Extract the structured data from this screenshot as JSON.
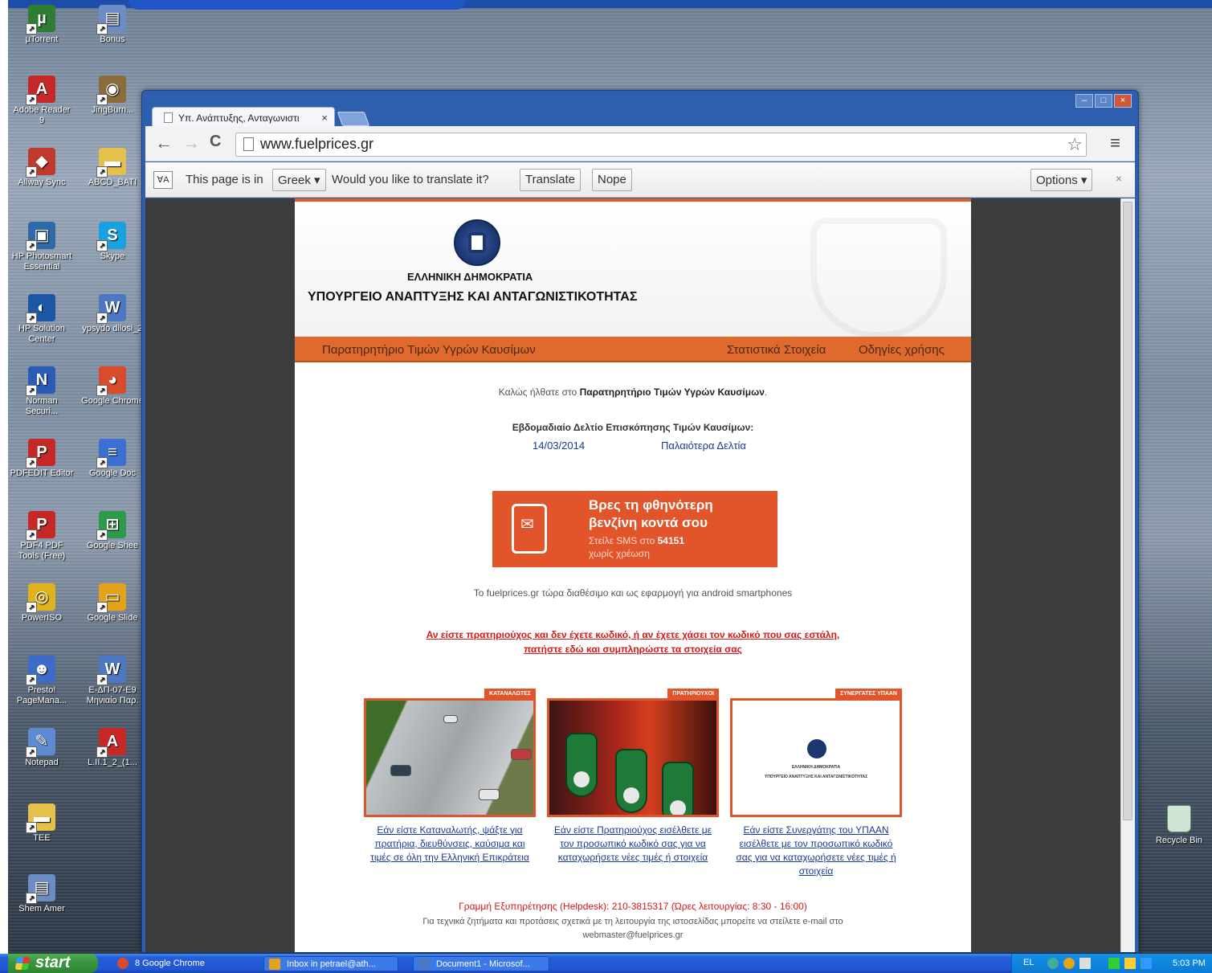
{
  "desktop": {
    "icons": [
      {
        "label": "µTorrent",
        "color": "#2f7d32",
        "glyph": "µ"
      },
      {
        "label": "Bonus",
        "color": "#6b8cc4",
        "glyph": "▤"
      },
      {
        "label": "Adobe Reader 9",
        "color": "#c62828",
        "glyph": "A"
      },
      {
        "label": "JingBurn...",
        "color": "#8a6d3b",
        "glyph": "◉"
      },
      {
        "label": "Allway Sync",
        "color": "#c0392b",
        "glyph": "◆"
      },
      {
        "label": "ABCD_BATI",
        "color": "#e5c04a",
        "glyph": "▬"
      },
      {
        "label": "HP Photosmart Essential",
        "color": "#2e6aa8",
        "glyph": "▣"
      },
      {
        "label": "Skype",
        "color": "#1aa1e0",
        "glyph": "S"
      },
      {
        "label": "HP Solution Center",
        "color": "#1c56a5",
        "glyph": "◐"
      },
      {
        "label": "ypsydo dilosi_2",
        "color": "#4c77c2",
        "glyph": "W"
      },
      {
        "label": "Norman Securi...",
        "color": "#2a5bb5",
        "glyph": "N"
      },
      {
        "label": "Google Chrome",
        "color": "#d94b2b",
        "glyph": "◕"
      },
      {
        "label": "PDFEDIT Editor",
        "color": "#c62828",
        "glyph": "P"
      },
      {
        "label": "Google Doc",
        "color": "#3b6fd1",
        "glyph": "≡"
      },
      {
        "label": "PDF4 PDF Tools (Free)",
        "color": "#c62828",
        "glyph": "P"
      },
      {
        "label": "Google Shee",
        "color": "#2c9a4a",
        "glyph": "⊞"
      },
      {
        "label": "PowerISO",
        "color": "#e0b21e",
        "glyph": "◎"
      },
      {
        "label": "Google Slide",
        "color": "#e3a21a",
        "glyph": "▭"
      },
      {
        "label": "Presto! PageMana...",
        "color": "#3c6cc9",
        "glyph": "☻"
      },
      {
        "label": "E-ΔΠ-07-Ε9 Μηνιαίο Παρ.",
        "color": "#4c77c2",
        "glyph": "W"
      },
      {
        "label": "Notepad",
        "color": "#5d8ad0",
        "glyph": "✎"
      },
      {
        "label": "L.II.1_2_(1...",
        "color": "#c62828",
        "glyph": "A"
      },
      {
        "label": "TEE",
        "color": "#e5c04a",
        "glyph": "▬"
      },
      {
        "label": "Shem Amer",
        "color": "#6b8cc4",
        "glyph": "▤"
      }
    ],
    "recycle_bin": "Recycle Bin"
  },
  "browser": {
    "tab_title": "Υπ. Ανάπτυξης, Ανταγωνιστι",
    "tab_close": "×",
    "win_controls": [
      "–",
      "□",
      "×"
    ],
    "nav": {
      "back": "←",
      "forward": "→",
      "reload": "C"
    },
    "url": "www.fuelprices.gr",
    "star": "☆",
    "menu": "≡",
    "translate_bar": {
      "icon": "ⱯA",
      "text_before": "This page is in",
      "language": "Greek ▾",
      "question": "Would you like to translate it?",
      "translate_button": "Translate",
      "nope_button": "Nope",
      "options_button": "Options ▾",
      "close": "×"
    }
  },
  "site": {
    "header_line1": "ΕΛΛΗΝΙΚΗ ΔΗΜΟΚΡΑΤΙΑ",
    "header_line2": "ΥΠΟΥΡΓΕΙΟ ΑΝΑΠΤΥΞΗΣ ΚΑΙ ΑΝΤΑΓΩΝΙΣΤΙΚΟΤΗΤΑΣ",
    "nav_left": "Παρατηρητήριο Τιμών Υγρών Καυσίμων",
    "nav_stats": "Στατιστικά Στοιχεία",
    "nav_guide": "Οδηγίες χρήσης",
    "welcome_prefix": "Καλώς ήλθατε στο",
    "welcome_bold": "Παρατηρητήριο Τιμών Υγρών Καυσίμων",
    "weekly_title": "Εβδομαδιαίο Δελτίο Επισκόπησης Τιμών Καυσίμων:",
    "weekly_date": "14/03/2014",
    "older_bulletins": "Παλαιότερα Δελτία",
    "sms_line1": "Βρες τη φθηνότερη",
    "sms_line2": "βενζίνη κοντά σου",
    "sms_line3_prefix": "Στείλε SMS στο",
    "sms_number": "54151",
    "sms_line4": "χωρίς χρέωση",
    "android_text": "Το fuelprices.gr τώρα διαθέσιμο και ως εφαρμογή για android smartphones",
    "red_link_line1": "Αν είστε πρατηριούχος και δεν έχετε κωδικό, ή αν έχετε χάσει τον κωδικό που σας εστάλη,",
    "red_link_line2": "πατήστε εδώ και συμπληρώστε τα στοιχεία σας",
    "cards": [
      {
        "tag": "ΚΑΤΑΝΑΛΩΤΕΣ",
        "caption": "Εάν είστε Καταναλωτής, ψάξτε για πρατήρια, διευθύνσεις, καύσιμα και τιμές σε όλη την Ελληνική Επικράτεια"
      },
      {
        "tag": "ΠΡΑΤΗΡΙΟΥΧΟΙ",
        "caption": "Εάν είστε Πρατηριούχος εισέλθετε με τον προσωπικό κωδικό σας για να καταχωρήσετε νέες τιμές ή στοιχεία"
      },
      {
        "tag": "ΣΥΝΕΡΓΑΤΕΣ ΥΠΑΑΝ",
        "caption": "Εάν είστε Συνεργάτης του ΥΠΑΑΝ εισέλθετε με τον προσωπικό κωδικό σας για να καταχωρήσετε νέες τιμές ή στοιχεία",
        "logo_line1": "ΕΛΛΗΝΙΚΗ ΔΗΜΟΚΡΑΤΙΑ",
        "logo_line2": "ΥΠΟΥΡΓΕΙΟ ΑΝΑΠΤΥΞΗΣ ΚΑΙ ΑΝΤΑΓΩΝΙΣΤΙΚΟΤΗΤΑΣ"
      }
    ],
    "helpdesk": "Γραμμή Εξυπηρέτησης (Helpdesk): 210-3815317 (Ώρες λειτουργίας: 8:30 - 16:00)",
    "tech_line1": "Για τεχνικά ζητήματα και προτάσεις σχετικά με τη λειτουργία της ιστοσελίδας μπορείτε να στείλετε e-mail στο",
    "tech_email": "webmaster@fuelprices.gr"
  },
  "taskbar": {
    "start": "start",
    "tasks": [
      {
        "label": "8 Google Chrome",
        "color": "#d94b2b"
      },
      {
        "label": "Inbox in petrael@ath...",
        "color": "#e5a21a"
      },
      {
        "label": "Document1 - Microsof...",
        "color": "#4c77c2"
      }
    ],
    "lang": "EL",
    "time": "5:03 PM"
  }
}
